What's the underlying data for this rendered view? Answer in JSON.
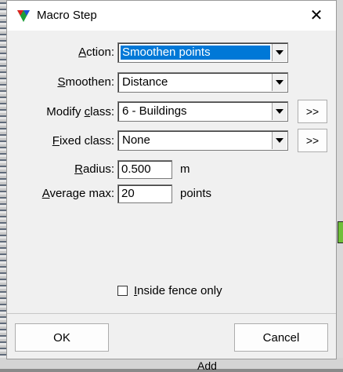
{
  "window": {
    "title": "Macro Step",
    "close_glyph": "✕"
  },
  "form": {
    "action": {
      "label": "Action:",
      "access_key": "A",
      "rest": "ction:",
      "value": "Smoothen points"
    },
    "smoothen": {
      "label": "Smoothen:",
      "access_key": "S",
      "rest": "moothen:",
      "value": "Distance"
    },
    "modify_class": {
      "pre": "Modify ",
      "access_key": "c",
      "rest": "lass:",
      "value": "6 - Buildings",
      "more_button": ">>"
    },
    "fixed_class": {
      "access_key": "F",
      "rest": "ixed class:",
      "value": "None",
      "more_button": ">>"
    },
    "radius": {
      "access_key": "R",
      "rest": "adius:",
      "value": "0.500",
      "unit": "m"
    },
    "average_max": {
      "access_key": "A",
      "rest": "verage max:",
      "value": "20",
      "unit": "points"
    },
    "inside_fence": {
      "access_key": "I",
      "rest": "nside fence only",
      "checked": false
    }
  },
  "buttons": {
    "ok": "OK",
    "cancel": "Cancel"
  },
  "background": {
    "add_label": "Add"
  }
}
